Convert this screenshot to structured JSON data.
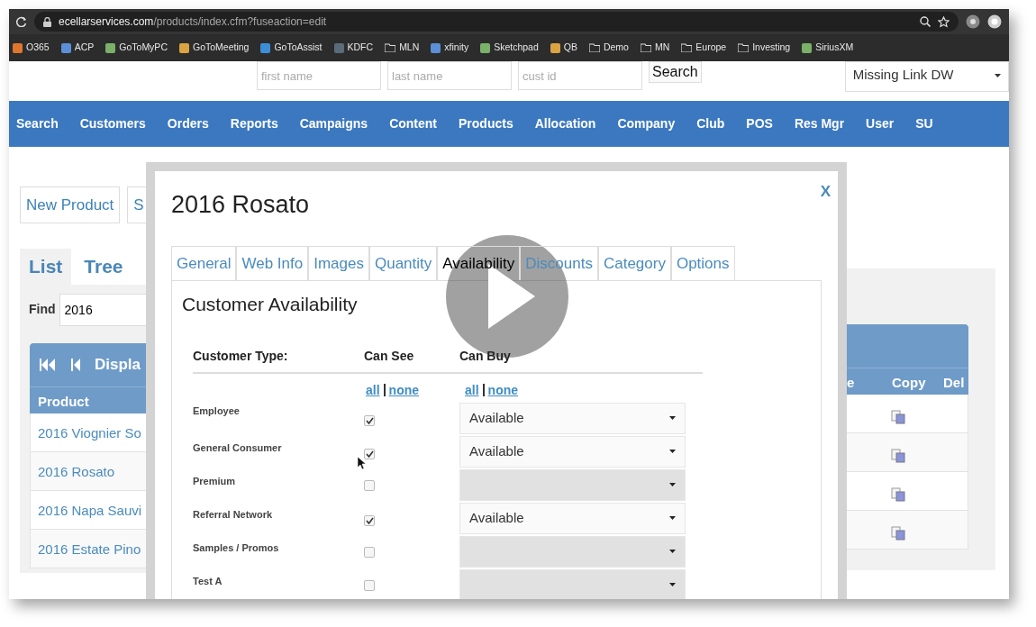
{
  "browser": {
    "url_host": "ecellarservices.com",
    "url_path": "/products/index.cfm?fuseaction=edit",
    "bookmarks": [
      {
        "label": "O365",
        "kind": "site"
      },
      {
        "label": "ACP",
        "kind": "site"
      },
      {
        "label": "GoToMyPC",
        "kind": "site"
      },
      {
        "label": "GoToMeeting",
        "kind": "site"
      },
      {
        "label": "GoToAssist",
        "kind": "site"
      },
      {
        "label": "KDFC",
        "kind": "site"
      },
      {
        "label": "MLN",
        "kind": "folder"
      },
      {
        "label": "xfinity",
        "kind": "site"
      },
      {
        "label": "Sketchpad",
        "kind": "site"
      },
      {
        "label": "QB",
        "kind": "site"
      },
      {
        "label": "Demo",
        "kind": "folder"
      },
      {
        "label": "MN",
        "kind": "folder"
      },
      {
        "label": "Europe",
        "kind": "folder"
      },
      {
        "label": "Investing",
        "kind": "folder"
      },
      {
        "label": "SiriusXM",
        "kind": "site"
      }
    ]
  },
  "header": {
    "fields": [
      {
        "placeholder": "first name"
      },
      {
        "placeholder": "last name"
      },
      {
        "placeholder": "cust id"
      }
    ],
    "search_button": "Search",
    "account_select": "Missing Link DW"
  },
  "nav": [
    "Search",
    "Customers",
    "Orders",
    "Reports",
    "Campaigns",
    "Content",
    "Products",
    "Allocation",
    "Company",
    "Club",
    "POS",
    "Res Mgr",
    "User",
    "SU"
  ],
  "page": {
    "buttons": [
      "New Product",
      "S"
    ],
    "view_tabs": [
      {
        "label": "List",
        "selected": true
      },
      {
        "label": "Tree",
        "selected": false
      }
    ],
    "find": {
      "label": "Find",
      "value": "2016"
    },
    "grid": {
      "pager_text": "Displa",
      "columns_left": [
        "Product"
      ],
      "columns_right": [
        "e",
        "Copy",
        "Del"
      ],
      "rows": [
        {
          "product": "2016 Viognier So"
        },
        {
          "product": "2016 Rosato"
        },
        {
          "product": "2016 Napa Sauvi"
        },
        {
          "product": "2016 Estate Pino"
        }
      ]
    }
  },
  "modal": {
    "title": "2016 Rosato",
    "close": "X",
    "tabs": [
      {
        "label": "General",
        "selected": false
      },
      {
        "label": "Web Info",
        "selected": false
      },
      {
        "label": "Images",
        "selected": false
      },
      {
        "label": "Quantity",
        "selected": false
      },
      {
        "label": "Availability",
        "selected": true
      },
      {
        "label": "Discounts",
        "selected": false
      },
      {
        "label": "Category",
        "selected": false
      },
      {
        "label": "Options",
        "selected": false
      }
    ],
    "section_title": "Customer Availability",
    "columns": [
      "Customer Type:",
      "Can See",
      "Can Buy"
    ],
    "see_links": [
      "all",
      "none"
    ],
    "buy_links": [
      "all",
      "none"
    ],
    "rows": [
      {
        "type": "Employee",
        "can_see": true,
        "can_buy": "Available",
        "disabled": false
      },
      {
        "type": "General Consumer",
        "can_see": true,
        "can_buy": "Available",
        "disabled": false
      },
      {
        "type": "Premium",
        "can_see": false,
        "disabled": true
      },
      {
        "type": "Referral Network",
        "can_see": true,
        "can_buy": "Available",
        "disabled": false
      },
      {
        "type": "Samples / Promos",
        "can_see": false,
        "disabled": true
      },
      {
        "type": "Test A",
        "can_see": false,
        "disabled": true
      }
    ]
  }
}
